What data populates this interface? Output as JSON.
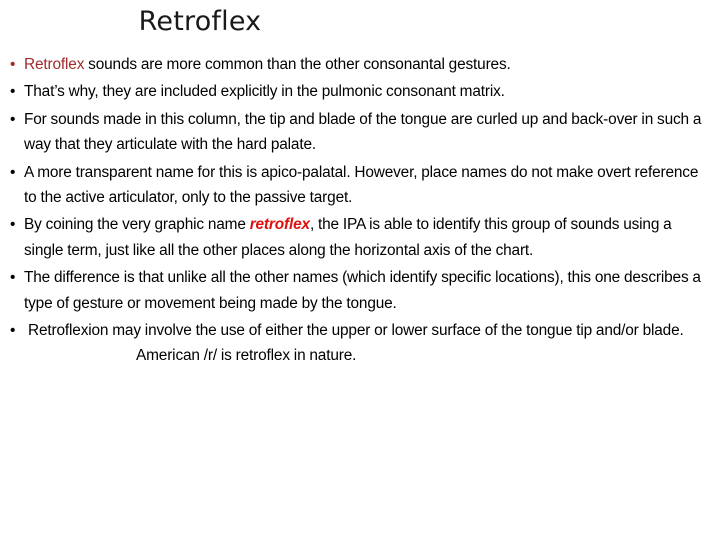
{
  "slide": {
    "title": "Retroflex",
    "background_color": "#ffffff",
    "text_color": "#000000",
    "accent_dark_red": "#A02B2B",
    "accent_bright_red": "#DE0F0F",
    "bullets": [
      {
        "id": "bullet-1",
        "marker": "•",
        "marker_color": "#A02B2B",
        "emphasis_word": "Retroflex",
        "emphasis_style": "dark-red",
        "rest": " sounds are more common than the other consonantal gestures.",
        "full_text": "Retroflex sounds are more common than the other consonantal gestures."
      },
      {
        "id": "bullet-2",
        "marker": "•",
        "marker_color": "#000000",
        "full_text": "That’s why, they are included explicitly in the pulmonic consonant matrix."
      },
      {
        "id": "bullet-3",
        "marker": "•",
        "marker_color": "#000000",
        "full_text": "For sounds made in this column, the tip and blade of the tongue are curled up and back-over in such a way that they articulate with the hard palate."
      },
      {
        "id": "bullet-4",
        "marker": "•",
        "marker_color": "#000000",
        "full_text": "A more transparent name for this is apico-palatal. However, place names do not make overt reference to the active articulator, only to the passive target."
      },
      {
        "id": "bullet-5",
        "marker": "•",
        "marker_color": "#000000",
        "prefix": "By coining the very graphic name ",
        "emphasis_word": "retroflex",
        "emphasis_style": "bright-red-bold-italic",
        "suffix": ", the IPA is able to identify this group of sounds using a single term, just like all the other places along the horizontal axis of the chart.",
        "full_text": "By coining the very graphic name retroflex, the IPA is able to identify this group of sounds using a single term, just like all the other places along the horizontal axis of the chart."
      },
      {
        "id": "bullet-6",
        "marker": "•",
        "marker_color": "#000000",
        "full_text": "The difference is that unlike all the other names (which identify specific locations), this one describes a type of gesture or movement being made by the tongue."
      },
      {
        "id": "bullet-7",
        "marker": "•",
        "marker_color": "#000000",
        "segment_a": " Retroflexion may involve the use of either the upper or lower surface of the tongue tip and/or blade.",
        "segment_b": "American /r/ is retroflex in nature.",
        "full_text": " Retroflexion may involve the use of either the upper or lower surface of the tongue tip and/or blade.          American /r/ is retroflex in nature."
      }
    ]
  }
}
